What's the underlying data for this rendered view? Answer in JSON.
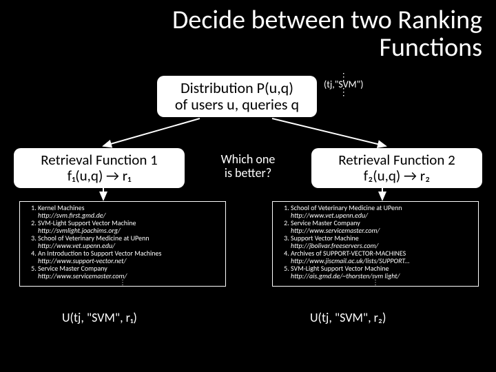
{
  "title": "Decide between two Ranking Functions",
  "distribution": {
    "line1": "Distribution P(u,q)",
    "line2": "of users u, queries q"
  },
  "side_sample": "(tj,\"SVM\")",
  "rf1": {
    "line1": "Retrieval Function 1",
    "line2": "f₁(u,q) → r₁"
  },
  "rf2": {
    "line1": "Retrieval Function 2",
    "line2": "f₂(u,q) → r₂"
  },
  "mid": {
    "line1": "Which one",
    "line2": "is better?"
  },
  "results1": [
    {
      "title": "Kernel Machines",
      "url": "http://svm.first.gmd.de/"
    },
    {
      "title": "SVM-Light Support Vector Machine",
      "url": "http://svmlight.joachims.org/"
    },
    {
      "title": "School of Veterinary Medicine at UPenn",
      "url": "http://www.vet.upenn.edu/"
    },
    {
      "title": "An Introduction to Support Vector Machines",
      "url": "http://www.support-vector.net/"
    },
    {
      "title": "Service Master Company",
      "url": "http://www.servicemaster.com/"
    }
  ],
  "results2": [
    {
      "title": "School of Veterinary Medicine at UPenn",
      "url": "http://www.vet.upenn.edu/"
    },
    {
      "title": "Service Master Company",
      "url": "http://www.servicemaster.com/"
    },
    {
      "title": "Support Vector Machine",
      "url": "http://jbolivar.freeservers.com/"
    },
    {
      "title": "Archives of SUPPORT-VECTOR-MACHINES",
      "url": "http://www.jiscmail.ac.uk/lists/SUPPORT..."
    },
    {
      "title": "SVM-Light Support Vector Machine",
      "url": "http://ais.gmd.de/~thorsten/svm light/"
    }
  ],
  "utility1": "U(tj, \"SVM\", r₁)",
  "utility2": "U(tj, \"SVM\", r₂)",
  "dots": "⋮"
}
